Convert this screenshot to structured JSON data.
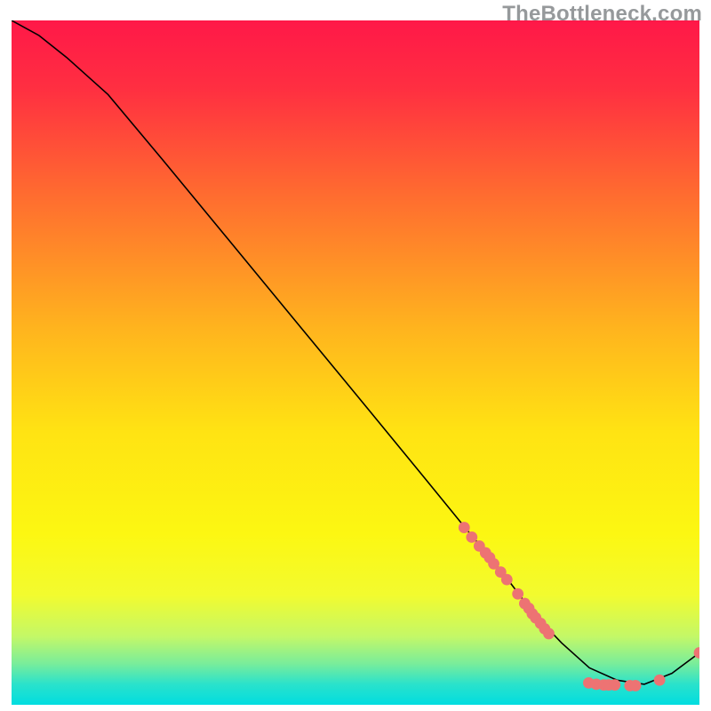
{
  "watermark": "TheBottleneck.com",
  "chart_data": {
    "type": "line",
    "title": "",
    "xlabel": "",
    "ylabel": "",
    "xlim": [
      0,
      100
    ],
    "ylim": [
      0,
      100
    ],
    "grid": false,
    "legend": false,
    "background": {
      "type": "vertical-gradient",
      "stops": [
        {
          "at": 0.0,
          "color": "#ff1848"
        },
        {
          "at": 0.1,
          "color": "#ff2f41"
        },
        {
          "at": 0.25,
          "color": "#ff6a30"
        },
        {
          "at": 0.45,
          "color": "#ffb41e"
        },
        {
          "at": 0.6,
          "color": "#ffe313"
        },
        {
          "at": 0.75,
          "color": "#fcf712"
        },
        {
          "at": 0.84,
          "color": "#f2fb2f"
        },
        {
          "at": 0.9,
          "color": "#c4f867"
        },
        {
          "at": 0.94,
          "color": "#79ed9b"
        },
        {
          "at": 0.97,
          "color": "#2ae2cb"
        },
        {
          "at": 1.0,
          "color": "#01dde0"
        }
      ]
    },
    "series": [
      {
        "name": "curve",
        "type": "line",
        "color": "#000000",
        "width": 1.6,
        "x": [
          0,
          4,
          8,
          14,
          22,
          32,
          42,
          52,
          60,
          66,
          71,
          76,
          80,
          84,
          88,
          92,
          96,
          100
        ],
        "y": [
          100,
          97.8,
          94.6,
          89.2,
          79.6,
          67.4,
          55.2,
          43.0,
          33.2,
          25.8,
          19.8,
          13.2,
          9.0,
          5.4,
          3.6,
          3.0,
          4.6,
          7.6
        ]
      },
      {
        "name": "cluster-upper",
        "type": "scatter",
        "color": "#ed7373",
        "marker_radius": 6.4,
        "points": [
          {
            "x": 65.8,
            "y": 25.9
          },
          {
            "x": 66.9,
            "y": 24.5
          },
          {
            "x": 68.0,
            "y": 23.2
          },
          {
            "x": 68.9,
            "y": 22.2
          },
          {
            "x": 69.5,
            "y": 21.5
          },
          {
            "x": 70.1,
            "y": 20.6
          },
          {
            "x": 71.1,
            "y": 19.4
          },
          {
            "x": 72.0,
            "y": 18.3
          },
          {
            "x": 73.6,
            "y": 16.2
          },
          {
            "x": 74.6,
            "y": 14.8
          },
          {
            "x": 75.2,
            "y": 14.1
          },
          {
            "x": 75.7,
            "y": 13.3
          },
          {
            "x": 76.2,
            "y": 12.7
          },
          {
            "x": 76.9,
            "y": 11.9
          },
          {
            "x": 77.5,
            "y": 11.1
          },
          {
            "x": 78.1,
            "y": 10.4
          }
        ]
      },
      {
        "name": "cluster-bottom",
        "type": "scatter",
        "color": "#ed7373",
        "marker_radius": 6.4,
        "points": [
          {
            "x": 83.9,
            "y": 3.2
          },
          {
            "x": 85.0,
            "y": 3.0
          },
          {
            "x": 86.1,
            "y": 2.9
          },
          {
            "x": 86.8,
            "y": 2.9
          },
          {
            "x": 87.7,
            "y": 2.9
          },
          {
            "x": 89.9,
            "y": 2.8
          },
          {
            "x": 90.7,
            "y": 2.8
          },
          {
            "x": 94.2,
            "y": 3.6
          }
        ]
      },
      {
        "name": "end-point",
        "type": "scatter",
        "color": "#ed7373",
        "marker_radius": 6.4,
        "points": [
          {
            "x": 100.0,
            "y": 7.6
          }
        ]
      }
    ]
  }
}
